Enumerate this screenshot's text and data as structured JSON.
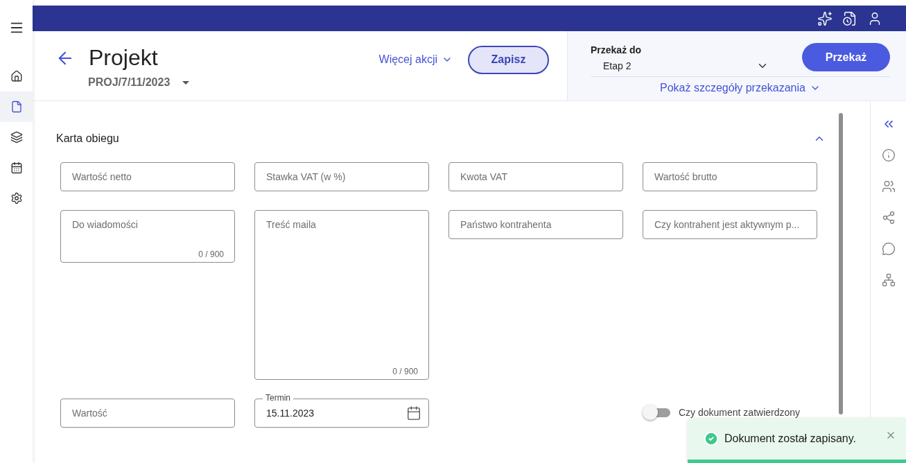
{
  "nav": [
    {
      "kind": "home",
      "selected": false
    },
    {
      "kind": "document",
      "selected": true
    },
    {
      "kind": "layers",
      "selected": false
    },
    {
      "kind": "calendar",
      "selected": false
    },
    {
      "kind": "settings",
      "selected": false
    }
  ],
  "header": {
    "title": "Projekt",
    "number": "PROJ/7/11/2023",
    "more_actions": "Więcej akcji",
    "save": "Zapisz"
  },
  "transfer": {
    "label": "Przekaż do",
    "value": "Etap 2",
    "button": "Przekaż",
    "details": "Pokaż szczegóły przekazania"
  },
  "section": {
    "title": "Karta obiegu",
    "expanded": true,
    "rows": [
      [
        {
          "kind": "text",
          "placeholder": "Wartość netto"
        },
        {
          "kind": "text",
          "placeholder": "Stawka VAT (w %)"
        },
        {
          "kind": "text",
          "placeholder": "Kwota VAT"
        },
        {
          "kind": "text",
          "placeholder": "Wartość brutto"
        }
      ],
      [
        {
          "kind": "textarea",
          "placeholder": "Do wiadomości",
          "counter": "0 / 900"
        },
        {
          "kind": "long-textarea",
          "placeholder": "Treść maila",
          "counter": "0 / 900"
        },
        {
          "kind": "text",
          "placeholder": "Państwo kontrahenta"
        },
        {
          "kind": "text",
          "placeholder": "Czy kontrahent jest aktywnym p..."
        }
      ],
      [
        {
          "kind": "text",
          "placeholder": "Wartość"
        },
        {
          "kind": "date",
          "label": "Termin",
          "value": "15.11.2023"
        },
        {
          "kind": "empty"
        },
        {
          "kind": "toggle",
          "label": "Czy dokument zatwierdzony",
          "on": false
        }
      ]
    ]
  },
  "toast": {
    "message": "Dokument został zapisany."
  }
}
